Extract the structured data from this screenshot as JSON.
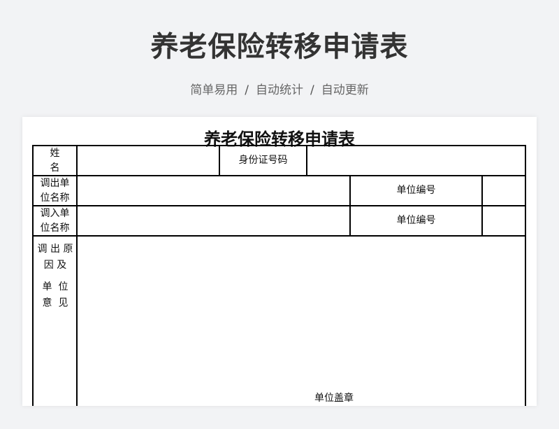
{
  "header": {
    "title": "养老保险转移申请表",
    "features": [
      "简单易用",
      "自动统计",
      "自动更新"
    ],
    "separator": "/"
  },
  "form": {
    "title": "养老保险转移申请表",
    "name_label": "姓名",
    "id_label": "身份证号码",
    "out_unit_label_line1": "调出单",
    "out_unit_label_line2": "位名称",
    "out_unit_code_label": "单位编号",
    "in_unit_label_line1": "调入单",
    "in_unit_label_line2": "位名称",
    "in_unit_code_label": "单位编号",
    "reason_label_line1": "调 出 原",
    "reason_label_line2": "因 及",
    "reason_label_line3": "单  位",
    "reason_label_line4": "意  见",
    "stamp_label": "单位盖章"
  }
}
